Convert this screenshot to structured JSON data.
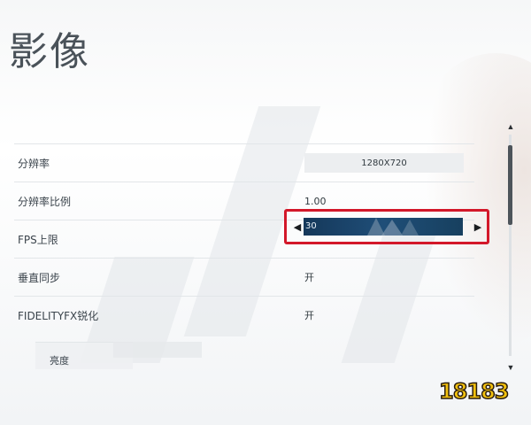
{
  "screen": {
    "title": "影像"
  },
  "settings": {
    "resolution": {
      "label": "分辨率",
      "value": "1280X720"
    },
    "resolution_scale": {
      "label": "分辨率比例",
      "value": "1.00"
    },
    "fps_limit": {
      "label": "FPS上限",
      "value": "30"
    },
    "vsync": {
      "label": "垂直同步",
      "value": "开"
    },
    "fidelityfx": {
      "label": "FIDELITYFX锐化",
      "value": "开"
    },
    "brightness": {
      "label": "亮度"
    }
  },
  "watermark": {
    "text": "18183",
    "colors": {
      "fill": "#f3c10e",
      "outline": "#2a1e10"
    }
  },
  "colors": {
    "highlight": "#d3182a",
    "stepper_fill": "#1f4e78"
  }
}
